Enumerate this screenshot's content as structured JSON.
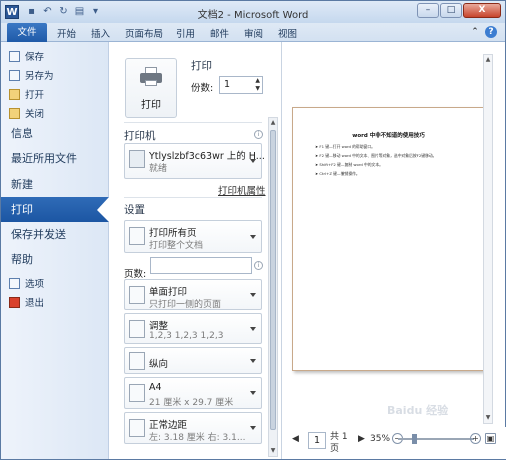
{
  "titlebar": {
    "title": "文档2 - Microsoft Word",
    "app_icon_letter": "W",
    "controls": [
      "–",
      "□",
      "X"
    ]
  },
  "ribbon": {
    "file_tab": "文件",
    "tabs": [
      "开始",
      "插入",
      "页面布局",
      "引用",
      "邮件",
      "审阅",
      "视图"
    ]
  },
  "nav": {
    "small_top": [
      "保存",
      "另存为",
      "打开",
      "关闭"
    ],
    "large": [
      "信息",
      "最近所用文件",
      "新建",
      "打印",
      "保存并发送",
      "帮助"
    ],
    "active": "打印",
    "small_bottom": [
      "选项",
      "退出"
    ]
  },
  "print": {
    "section_title": "打印",
    "button_label": "打印",
    "copies_label": "份数:",
    "copies_value": "1",
    "printer_title": "打印机",
    "printer_name": "Ytlyslzbf3c63wr 上的 H...",
    "printer_status": "就绪",
    "printer_props_link": "打印机属性",
    "settings_title": "设置",
    "pages_label": "页数:",
    "dropdowns": [
      {
        "l1": "打印所有页",
        "l2": "打印整个文档"
      },
      {
        "l1": "单面打印",
        "l2": "只打印一侧的页面"
      },
      {
        "l1": "调整",
        "l2": "1,2,3    1,2,3    1,2,3"
      },
      {
        "l1": "纵向",
        "l2": ""
      },
      {
        "l1": "A4",
        "l2": "21 厘米 x 29.7 厘米"
      },
      {
        "l1": "正常边距",
        "l2": "左: 3.18 厘米    右: 3.1..."
      }
    ]
  },
  "preview": {
    "doc_title": "word 中非不知道的使用技巧",
    "doc_lines": [
      "F1 键—打开 word 的帮助窗口。",
      "F2 键—移动 word 中的文本、图片等对象，选中对象后按F2键移动。",
      "Shift+F2 键—复制 word 中的文本。",
      "Ctrl+Z 键—撤销操作。"
    ],
    "page_current": "1",
    "page_total_prefix": "共 1",
    "page_total_suffix": "页",
    "zoom": "35%",
    "watermark": "Baidu 经验"
  }
}
